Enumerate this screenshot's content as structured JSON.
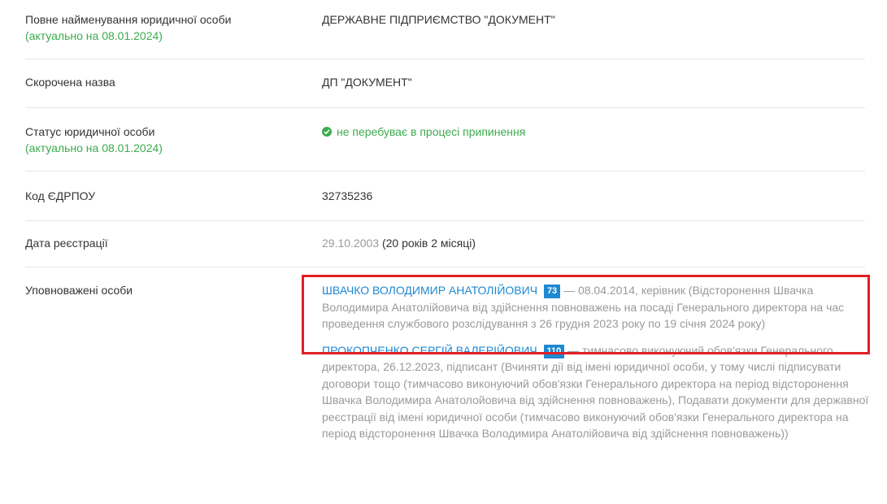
{
  "rows": {
    "full_name": {
      "label": "Повне найменування юридичної особи",
      "updated": "(актуально на 08.01.2024)",
      "value": "ДЕРЖАВНЕ ПІДПРИЄМСТВО \"ДОКУМЕНТ\""
    },
    "short_name": {
      "label": "Скорочена назва",
      "value": "ДП \"ДОКУМЕНТ\""
    },
    "status": {
      "label": "Статус юридичної особи",
      "updated": "(актуально на 08.01.2024)",
      "value": "не перебуває в процесі припинення",
      "icon": "check-circle-icon"
    },
    "code": {
      "label": "Код ЄДРПОУ",
      "value": "32735236"
    },
    "reg_date": {
      "label": "Дата реєстрації",
      "date": "29.10.2003",
      "age": "(20 років 2 місяці)"
    },
    "authorized": {
      "label": "Уповноважені особи",
      "persons": [
        {
          "name": "ШВАЧКО ВОЛОДИМИР АНАТОЛІЙОВИЧ",
          "badge": "73",
          "details": "— 08.04.2014, керівник (Відсторонення Швачка Володимира Анатолійовича від здійснення повноважень на посаді Генерального директора на час проведення службового розслідування з 26 грудня 2023 року по 19 січня 2024 року)"
        },
        {
          "name": "ПРОКОПЧЕНКО СЕРГІЙ ВАЛЕРІЙОВИЧ",
          "badge": "110",
          "details": "— тимчасово виконуючий обов'язки Генерального директора, 26.12.2023, підписант (Вчиняти дії від імені юридичної особи, у тому числі підписувати договори тощо (тимчасово виконуючий обов'язки Генерального директора на період відсторонення Швачка Володимира Анатолойовича від здійснення повноважень), Подавати документи для державної реєстрації від імені юридичної особи (тимчасово виконуючий обов'язки Генерального директора на період відсторонення Швачка Володимира Анатолійовича від здійснення повноважень))"
        }
      ]
    }
  },
  "colors": {
    "link": "#1e88d1",
    "green": "#3bab4c",
    "muted": "#9a9a9a",
    "highlight": "#e11f24"
  }
}
